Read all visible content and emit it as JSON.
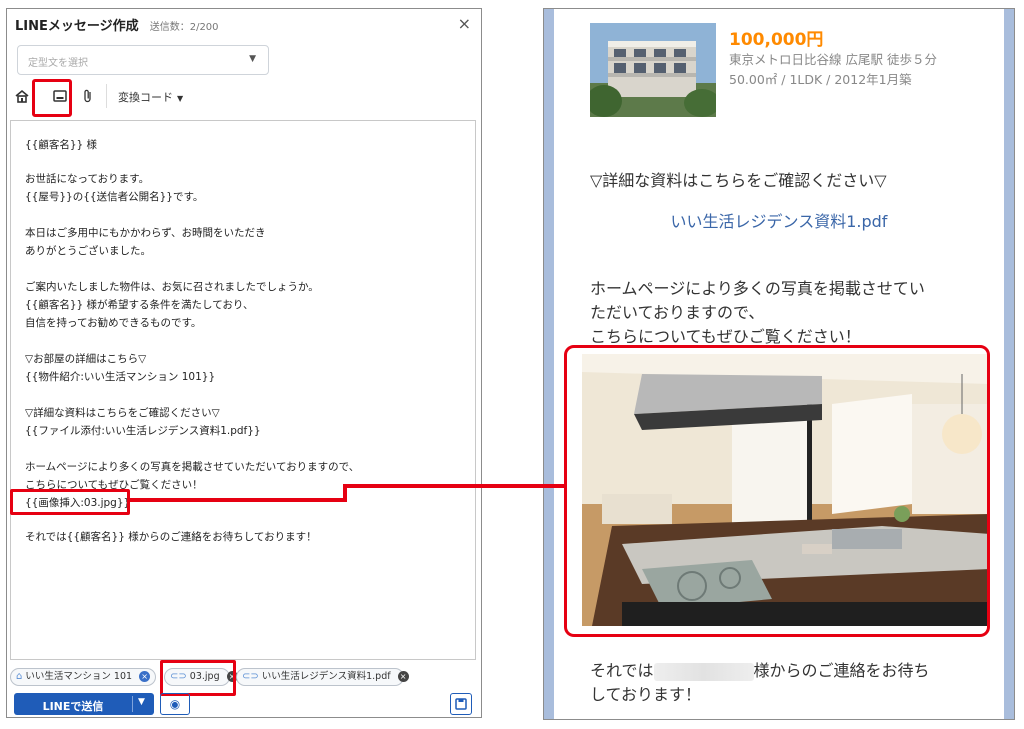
{
  "composer": {
    "title": "LINEメッセージ作成",
    "send_count": "送信数：2/200",
    "close": "×",
    "template_placeholder": "定型文を選択",
    "convert_code": "変換コード",
    "editor_lines": [
      "{{顧客名}} 様",
      "お世話になっております。",
      "{{屋号}}の{{送信者公開名}}です。",
      "本日はご多用中にもかかわらず、お時間をいただき",
      "ありがとうございました。",
      "ご案内いたしました物件は、お気に召されましたでしょうか。",
      "{{顧客名}} 様が希望する条件を満たしており、",
      "自信を持ってお勧めできるものです。",
      "▽お部屋の詳細はこちら▽",
      "{{物件紹介:いい生活マンション 101}}",
      "▽詳細な資料はこちらをご確認ください▽",
      "{{ファイル添付:いい生活レジデンス資料1.pdf}}",
      "ホームページにより多くの写真を掲載させていただいておりますので、",
      "こちらについてもぜひご覧ください！",
      "{{画像挿入:03.jpg}}",
      "それでは{{顧客名}} 様からのご連絡をお待ちしております！"
    ],
    "attachments": [
      {
        "label": "いい生活マンション 101",
        "icon": "house-icon"
      },
      {
        "label": "03.jpg",
        "icon": "link-icon"
      },
      {
        "label": "いい生活レジデンス資料1.pdf",
        "icon": "link-icon"
      }
    ],
    "send_label": "LINEで送信"
  },
  "preview": {
    "price": "100,000円",
    "meta_line1": "東京メトロ日比谷線 広尾駅 徒歩５分",
    "meta_line2": "50.00㎡ / 1LDK / 2012年1月築",
    "docs_heading": "▽詳細な資料はこちらをご確認ください▽",
    "pdf_link": "いい生活レジデンス資料1.pdf",
    "hp_line1": "ホームページにより多くの写真を掲載させてい",
    "hp_line2": "ただいておりますので、",
    "hp_line3": "こちらについてもぜひご覧ください！",
    "closing_before": "それでは",
    "closing_after": "様からのご連絡をお待ち",
    "closing_line2": "しております！"
  },
  "colors": {
    "accent": "#1f5cb8",
    "highlight": "#e60012",
    "price": "#ff8a00",
    "chat_bg": "#a9bddc"
  }
}
